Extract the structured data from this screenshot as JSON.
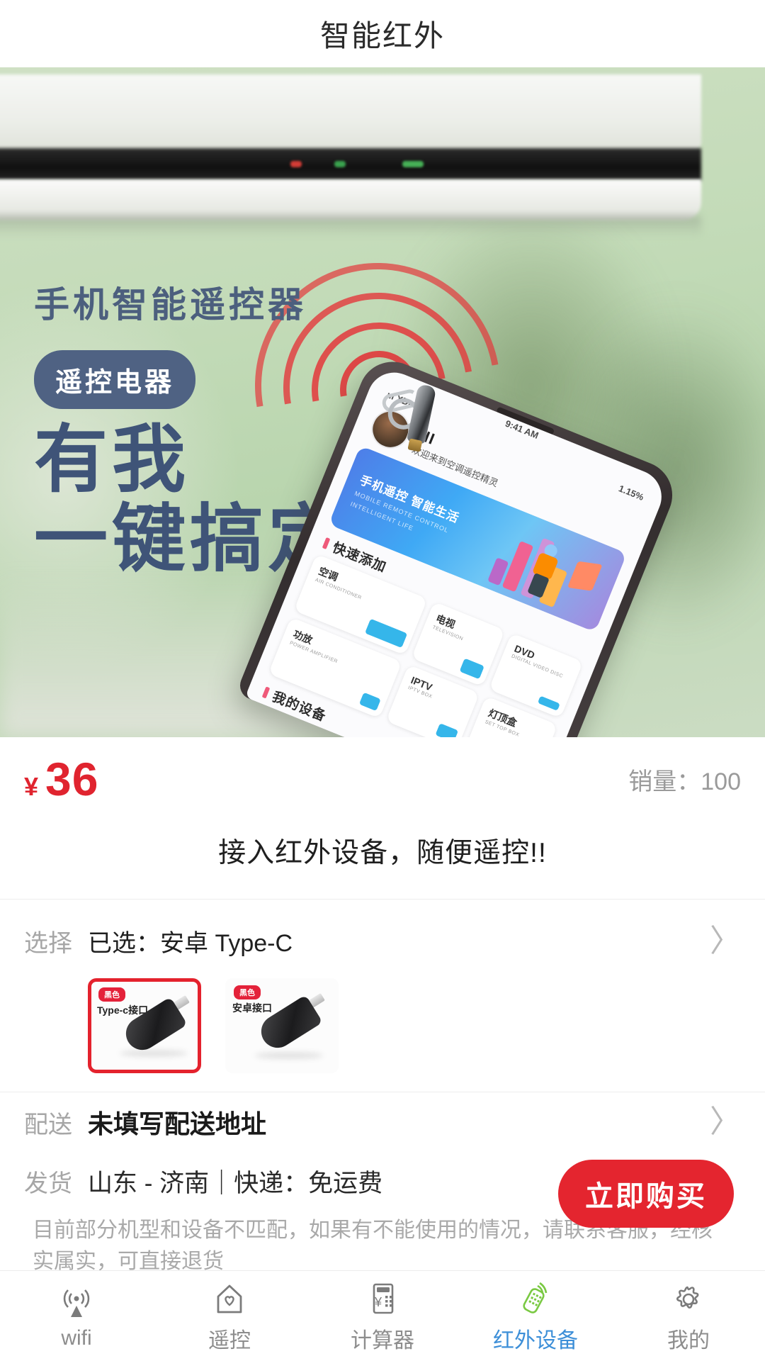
{
  "header": {
    "title": "智能红外"
  },
  "banner": {
    "headline": "手机智能遥控器",
    "pill": "遥控电器",
    "big_line1": "有我",
    "big_line2": "一键搞定",
    "phone": {
      "carrier": "ııl XDpwrls",
      "battery": "1.15%",
      "time": "9:41 AM",
      "greeting": "HI",
      "greeting_sub": "欢迎来到空调遥控精灵",
      "promo_cn": "手机遥控 智能生活",
      "promo_en1": "MOBILE REMOTE CONTROL",
      "promo_en2": "INTELLIGENT LIFE",
      "quick_add": "快速添加",
      "my_devices": "我的设备",
      "cards": [
        {
          "cn": "空调",
          "en": "AIR CONDITIONER"
        },
        {
          "cn": "电视",
          "en": "TELEVISION"
        },
        {
          "cn": "DVD",
          "en": "DIGITAL VIDEO DISC"
        },
        {
          "cn": "功放",
          "en": "POWER AMPLIFIER"
        },
        {
          "cn": "IPTV",
          "en": "IPTV BOX"
        },
        {
          "cn": "灯顶盒",
          "en": "SET TOP BOX"
        }
      ]
    }
  },
  "price": {
    "currency": "¥",
    "amount": "36",
    "sales_label": "销量：100"
  },
  "description": "接入红外设备，随便遥控!!",
  "select": {
    "label": "选择",
    "value": "已选：安卓 Type-C",
    "chevron": "〉",
    "options": [
      {
        "badge": "黑色",
        "label": "Type-c接口",
        "selected": true
      },
      {
        "badge": "黑色",
        "label": "安卓接口",
        "selected": false
      }
    ]
  },
  "delivery": {
    "label": "配送",
    "value": "未填写配送地址",
    "chevron": "〉"
  },
  "shipping": {
    "label": "发货",
    "value": "山东 - 济南｜快递：免运费"
  },
  "fineprint": "目前部分机型和设备不匹配，如果有不能使用的情况，请联系客服，经核实属实，可直接退货",
  "buy_button": {
    "label": "立即购买"
  },
  "nav": {
    "items": [
      {
        "label": "wifi",
        "icon": "wifi-signal-icon",
        "active": false
      },
      {
        "label": "遥控",
        "icon": "home-heart-icon",
        "active": false
      },
      {
        "label": "计算器",
        "icon": "calculator-icon",
        "active": false
      },
      {
        "label": "红外设备",
        "icon": "infrared-remote-icon",
        "active": true
      },
      {
        "label": "我的",
        "icon": "gear-icon",
        "active": false
      }
    ]
  },
  "colors": {
    "price_red": "#e0242f",
    "buy_red": "#e4252f",
    "active_blue": "#3d8fd8",
    "muted_gray": "#a6a6a6",
    "banner_navy": "#3f5478",
    "ir_wave_red": "#e4393c",
    "nav_green": "#7ac943"
  }
}
